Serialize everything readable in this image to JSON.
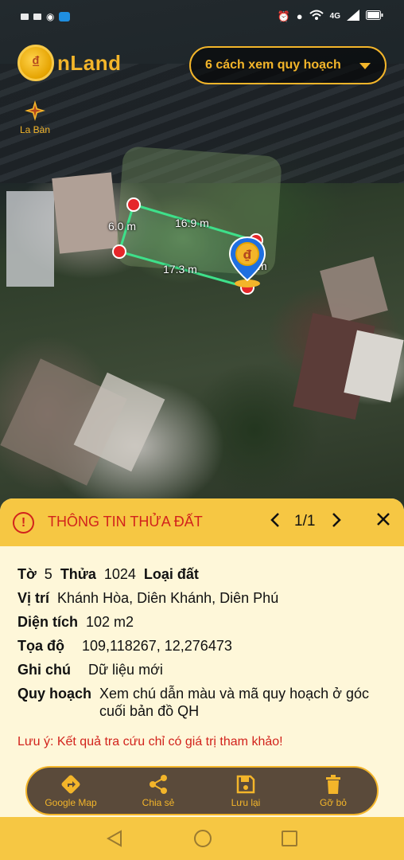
{
  "status_bar": {
    "left_icons": [
      "message-icon",
      "message-icon",
      "facebook-icon",
      "zalo-icon"
    ],
    "right_icons": [
      "alarm-icon",
      "location-icon",
      "wifi-icon",
      "4g-signal-icon",
      "signal-icon",
      "battery-icon"
    ],
    "network_label": "4G"
  },
  "header": {
    "logo_glyph": "₫",
    "logo_text": "nLand",
    "plan_dropdown_label": "6 cách xem quy hoạch"
  },
  "compass": {
    "label": "La Bàn"
  },
  "plot": {
    "dimensions": [
      "6.0 m",
      "16.9 m",
      "17.3 m",
      "m"
    ]
  },
  "sheet": {
    "title": "THÔNG TIN THỬA ĐẤT",
    "pager": "1/1",
    "close": "✕",
    "prev": "‹",
    "next": "›",
    "info_icon": "!",
    "row1": {
      "to_label": "Tờ",
      "to_value": "5",
      "thua_label": "Thửa",
      "thua_value": "1024",
      "loai_label": "Loại đất",
      "loai_value": ""
    },
    "vi_tri_label": "Vị trí",
    "vi_tri_value": "Khánh Hòa, Diên Khánh, Diên Phú",
    "dien_tich_label": "Diện tích",
    "dien_tich_value": "102 m2",
    "toa_do_label": "Tọa độ",
    "toa_do_value": "109,118267, 12,276473",
    "ghi_chu_label": "Ghi chú",
    "ghi_chu_value": "Dữ liệu mới",
    "quy_hoach_label": "Quy hoạch",
    "quy_hoach_value": "Xem chú dẫn màu và mã quy hoạch ở góc cuối bản đồ QH",
    "note": "Lưu ý: Kết quả tra cứu chỉ có giá trị tham khảo!",
    "actions": [
      {
        "label": "Google Map",
        "icon": "directions-icon"
      },
      {
        "label": "Chia sẻ",
        "icon": "share-icon"
      },
      {
        "label": "Lưu lại",
        "icon": "save-icon"
      },
      {
        "label": "Gỡ bỏ",
        "icon": "trash-icon"
      }
    ]
  },
  "colors": {
    "accent_gold": "#f3b52a",
    "header_yellow": "#f6c743",
    "alert_red": "#d2231c",
    "sheet_bg": "#fef7d9",
    "plot_line": "#3ee08a"
  }
}
